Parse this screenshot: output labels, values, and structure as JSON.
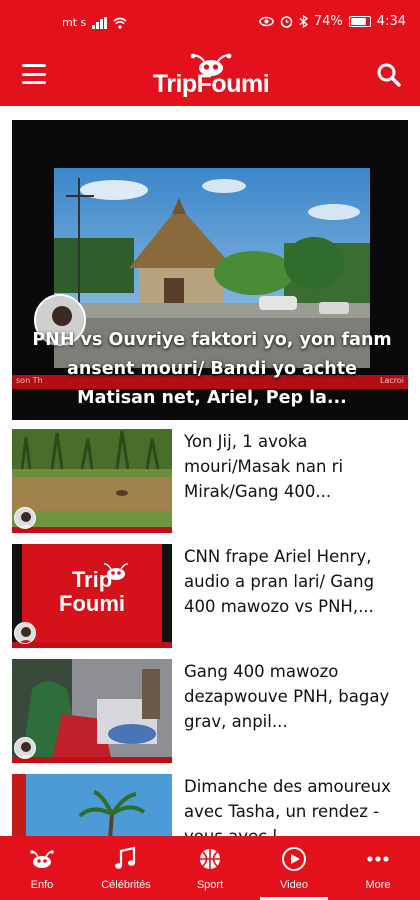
{
  "status_bar": {
    "carrier": "mt s",
    "battery": "74%",
    "time": "4:34",
    "battery_level": 0.74
  },
  "header": {
    "logo_text": "TripFoumi",
    "menu_icon": "hamburger-menu-icon",
    "search_icon": "search-icon"
  },
  "featured": {
    "title": "PNH vs Ouvriye faktori yo, yon fanm ansent mouri/ Bandi yo achte Matisan net, Ariel, Pep la...",
    "ticker_left": "son Th",
    "ticker_right": "Lacroi"
  },
  "articles": [
    {
      "title": "Yon Jij, 1 avoka mouri/Masak nan ri Mirak/Gang 400..."
    },
    {
      "title": "CNN frape Ariel Henry, audio a pran lari/ Gang 400 mawozo vs PNH,...",
      "thumb_logo": "Trip Foumi"
    },
    {
      "title": "Gang 400 mawozo dezapwouve PNH, bagay grav, anpil..."
    },
    {
      "title": "Dimanche des amoureux avec Tasha, un rendez - vous avec l..."
    }
  ],
  "bottom_nav": {
    "items": [
      {
        "label": "Enfo",
        "icon": "ant-logo-icon"
      },
      {
        "label": "Célébrités",
        "icon": "music-notes-icon"
      },
      {
        "label": "Sport",
        "icon": "basketball-icon"
      },
      {
        "label": "Video",
        "icon": "play-circle-icon",
        "active": true
      },
      {
        "label": "More",
        "icon": "more-dots-icon"
      }
    ]
  },
  "colors": {
    "brand_red": "#e3111b",
    "text": "#111111",
    "white": "#ffffff"
  }
}
